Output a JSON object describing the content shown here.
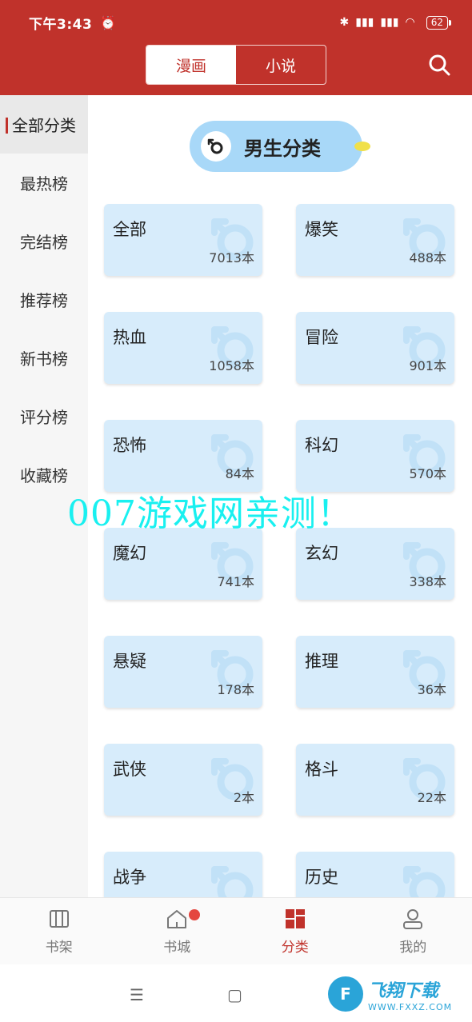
{
  "status_bar": {
    "time": "下午3:43",
    "alarm_icon": "alarm-icon",
    "battery": "62"
  },
  "top_tabs": [
    {
      "label": "漫画",
      "active": true
    },
    {
      "label": "小说",
      "active": false
    }
  ],
  "search_icon": "search-icon",
  "sidebar": {
    "items": [
      {
        "label": "全部分类",
        "active": true
      },
      {
        "label": "最热榜"
      },
      {
        "label": "完结榜"
      },
      {
        "label": "推荐榜"
      },
      {
        "label": "新书榜"
      },
      {
        "label": "评分榜"
      },
      {
        "label": "收藏榜"
      }
    ]
  },
  "section": {
    "title": "男生分类",
    "icon": "male-symbol-icon"
  },
  "categories": [
    {
      "name": "全部",
      "count": "7013本"
    },
    {
      "name": "爆笑",
      "count": "488本"
    },
    {
      "name": "热血",
      "count": "1058本"
    },
    {
      "name": "冒险",
      "count": "901本"
    },
    {
      "name": "恐怖",
      "count": "84本"
    },
    {
      "name": "科幻",
      "count": "570本"
    },
    {
      "name": "魔幻",
      "count": "741本"
    },
    {
      "name": "玄幻",
      "count": "338本"
    },
    {
      "name": "悬疑",
      "count": "178本"
    },
    {
      "name": "推理",
      "count": "36本"
    },
    {
      "name": "武侠",
      "count": "2本"
    },
    {
      "name": "格斗",
      "count": "22本"
    },
    {
      "name": "战争",
      "count": ""
    },
    {
      "name": "历史",
      "count": ""
    }
  ],
  "overlay_text": "007游戏网亲测！",
  "bottom_nav": [
    {
      "label": "书架",
      "icon": "bookshelf-icon"
    },
    {
      "label": "书城",
      "icon": "home-icon",
      "badge": true
    },
    {
      "label": "分类",
      "icon": "category-grid-icon",
      "active": true
    },
    {
      "label": "我的",
      "icon": "user-icon"
    }
  ],
  "brand": {
    "logo_text": "F",
    "title": "飞翔下载",
    "url": "WWW.FXXZ.COM"
  },
  "colors": {
    "accent": "#c0322b",
    "card_bg": "#d7ecfb",
    "pill_bg": "#a8d8f8",
    "overlay": "#19f0f0"
  }
}
